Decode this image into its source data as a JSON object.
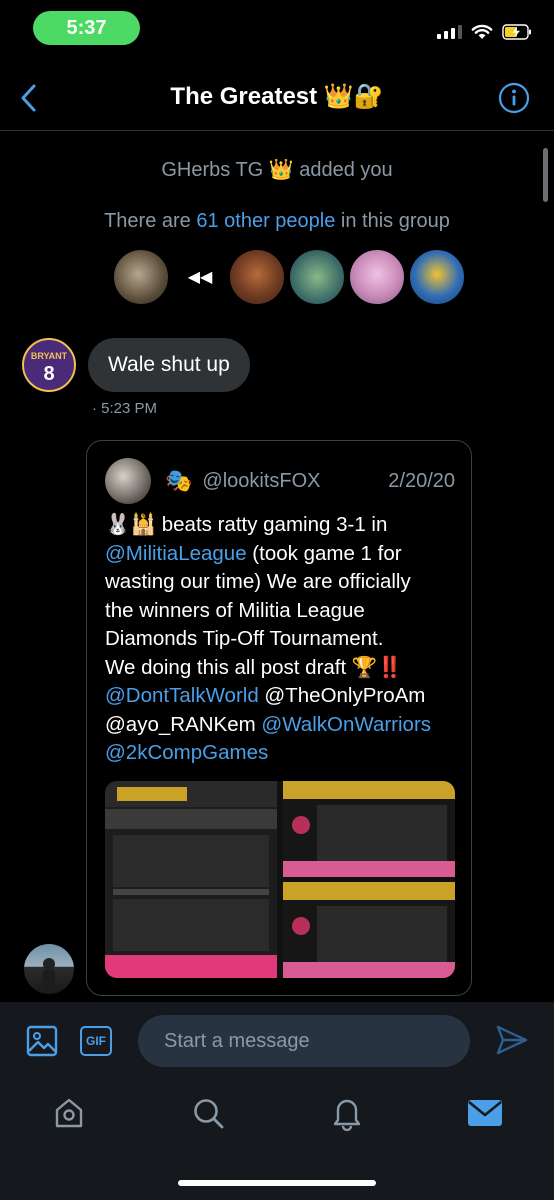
{
  "status_bar": {
    "time": "5:37"
  },
  "header": {
    "title": "The Greatest 👑🔐"
  },
  "conversation": {
    "system_added": "GHerbs TG 👑 added you",
    "members_prefix": "There are ",
    "members_link": "61 other people",
    "members_suffix": " in this group",
    "messages": [
      {
        "text": "Wale shut up",
        "time": "· 5:23 PM",
        "avatar_text": "BRYANT",
        "avatar_number": "8"
      }
    ]
  },
  "tweet": {
    "emoji": "🎭",
    "handle": "@lookitsFOX",
    "date": "2/20/20",
    "text_parts": [
      {
        "t": "🐰🕌 beats ratty gaming 3-1 in\n",
        "m": false
      },
      {
        "t": "@MilitiaLeague",
        "m": true
      },
      {
        "t": " (took game 1 for\nwasting our time) We are officially\nthe winners of Militia League\nDiamonds Tip-Off Tournament.\nWe doing this all post draft 🏆‼️\n",
        "m": false
      },
      {
        "t": "@DontTalkWorld",
        "m": true
      },
      {
        "t": " @TheOnlyProAm\n@ayo_RANKem ",
        "m": false
      },
      {
        "t": "@WalkOnWarriors",
        "m": true
      },
      {
        "t": "\n",
        "m": false
      },
      {
        "t": "@2kCompGames",
        "m": true
      }
    ]
  },
  "composer": {
    "placeholder": "Start a message",
    "gif_label": "GIF"
  },
  "colors": {
    "accent": "#4a9fe8",
    "status_pill": "#4cd964",
    "bubble": "#2f3336"
  }
}
